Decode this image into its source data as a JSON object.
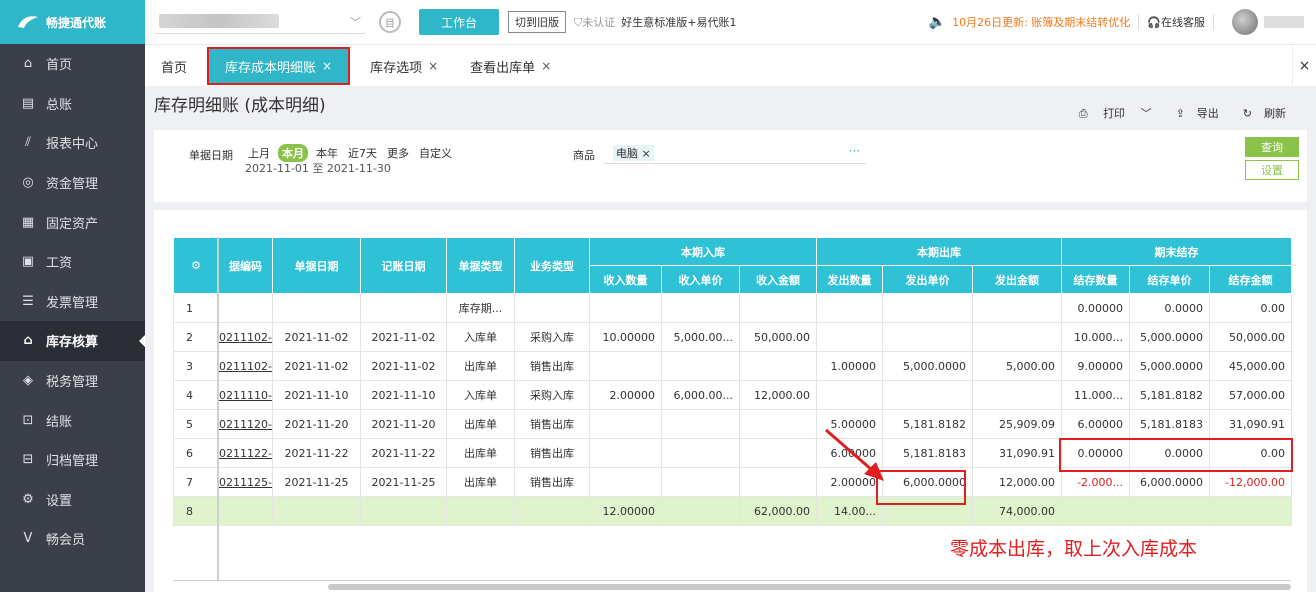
{
  "app": {
    "logo_text": "畅捷通代账"
  },
  "sidebar": {
    "items": [
      {
        "label": "首页",
        "icon": "home-icon"
      },
      {
        "label": "总账",
        "icon": "ledger-icon"
      },
      {
        "label": "报表中心",
        "icon": "chart-icon"
      },
      {
        "label": "资金管理",
        "icon": "money-icon"
      },
      {
        "label": "固定资产",
        "icon": "asset-icon"
      },
      {
        "label": "工资",
        "icon": "salary-icon"
      },
      {
        "label": "发票管理",
        "icon": "invoice-icon"
      },
      {
        "label": "库存核算",
        "icon": "inventory-icon",
        "active": true
      },
      {
        "label": "税务管理",
        "icon": "tax-icon"
      },
      {
        "label": "结账",
        "icon": "checkout-icon"
      },
      {
        "label": "归档管理",
        "icon": "archive-icon"
      },
      {
        "label": "设置",
        "icon": "gear-icon"
      },
      {
        "label": "畅会员",
        "icon": "member-icon"
      }
    ]
  },
  "topbar": {
    "workbench": "工作台",
    "switch_old": "切到旧版",
    "cert": "未认证",
    "version": "好生意标准版+易代账1",
    "notice": "10月26日更新: 账簿及期末结转优化",
    "service": "在线客服"
  },
  "tabs": [
    {
      "label": "首页",
      "closable": false
    },
    {
      "label": "库存成本明细账",
      "closable": true,
      "active": true
    },
    {
      "label": "库存选项",
      "closable": true
    },
    {
      "label": "查看出库单",
      "closable": true
    }
  ],
  "tab_close": "×",
  "close_char": "×",
  "page": {
    "title": "库存明细账 (成本明细)",
    "print": "打印",
    "export": "导出",
    "refresh": "刷新"
  },
  "filter": {
    "date_label": "单据日期",
    "chips": [
      "上月",
      "本月",
      "本年",
      "近7天",
      "更多",
      "自定义"
    ],
    "date_range": "2021-11-01 至 2021-11-30",
    "goods_label": "商品",
    "goods_tag": "电脑",
    "more": "···",
    "query": "查询",
    "settings": "设置"
  },
  "table": {
    "group_headers": [
      "本期入库",
      "本期出库",
      "期末结存"
    ],
    "headers": [
      "据编码",
      "单据日期",
      "记账日期",
      "单据类型",
      "业务类型",
      "收入数量",
      "收入单价",
      "收入金额",
      "发出数量",
      "发出单价",
      "发出金额",
      "结存数量",
      "结存单价",
      "结存金额"
    ],
    "rows": [
      [
        "1",
        "",
        "",
        "",
        "库存期...",
        "",
        "",
        "",
        "",
        "",
        "",
        "",
        "0.00000",
        "0.0000",
        "0.00"
      ],
      [
        "2",
        "0211102-0",
        "2021-11-02",
        "2021-11-02",
        "入库单",
        "采购入库",
        "10.00000",
        "5,000.00...",
        "50,000.00",
        "",
        "",
        "",
        "10.000...",
        "5,000.0000",
        "50,000.00"
      ],
      [
        "3",
        "0211102-0",
        "2021-11-02",
        "2021-11-02",
        "出库单",
        "销售出库",
        "",
        "",
        "",
        "1.00000",
        "5,000.0000",
        "5,000.00",
        "9.00000",
        "5,000.0000",
        "45,000.00"
      ],
      [
        "4",
        "0211110-0",
        "2021-11-10",
        "2021-11-10",
        "入库单",
        "采购入库",
        "2.00000",
        "6,000.00...",
        "12,000.00",
        "",
        "",
        "",
        "11.000...",
        "5,181.8182",
        "57,000.00"
      ],
      [
        "5",
        "0211120-0",
        "2021-11-20",
        "2021-11-20",
        "出库单",
        "销售出库",
        "",
        "",
        "",
        "5.00000",
        "5,181.8182",
        "25,909.09",
        "6.00000",
        "5,181.8183",
        "31,090.91"
      ],
      [
        "6",
        "0211122-0",
        "2021-11-22",
        "2021-11-22",
        "出库单",
        "销售出库",
        "",
        "",
        "",
        "6.00000",
        "5,181.8183",
        "31,090.91",
        "0.00000",
        "0.0000",
        "0.00"
      ],
      [
        "7",
        "0211125-0",
        "2021-11-25",
        "2021-11-25",
        "出库单",
        "销售出库",
        "",
        "",
        "",
        "2.00000",
        "6,000.0000",
        "12,000.00",
        "-2.000...",
        "6,000.0000",
        "-12,000.00"
      ],
      [
        "8",
        "",
        "",
        "",
        "",
        "",
        "12.00000",
        "",
        "62,000.00",
        "14.00...",
        "",
        "74,000.00",
        "",
        "",
        ""
      ]
    ]
  },
  "annotation": "零成本出库，取上次入库成本",
  "colors": {
    "accent": "#2fb6c8",
    "highlight": "#e02020",
    "green": "#8bc34a"
  }
}
